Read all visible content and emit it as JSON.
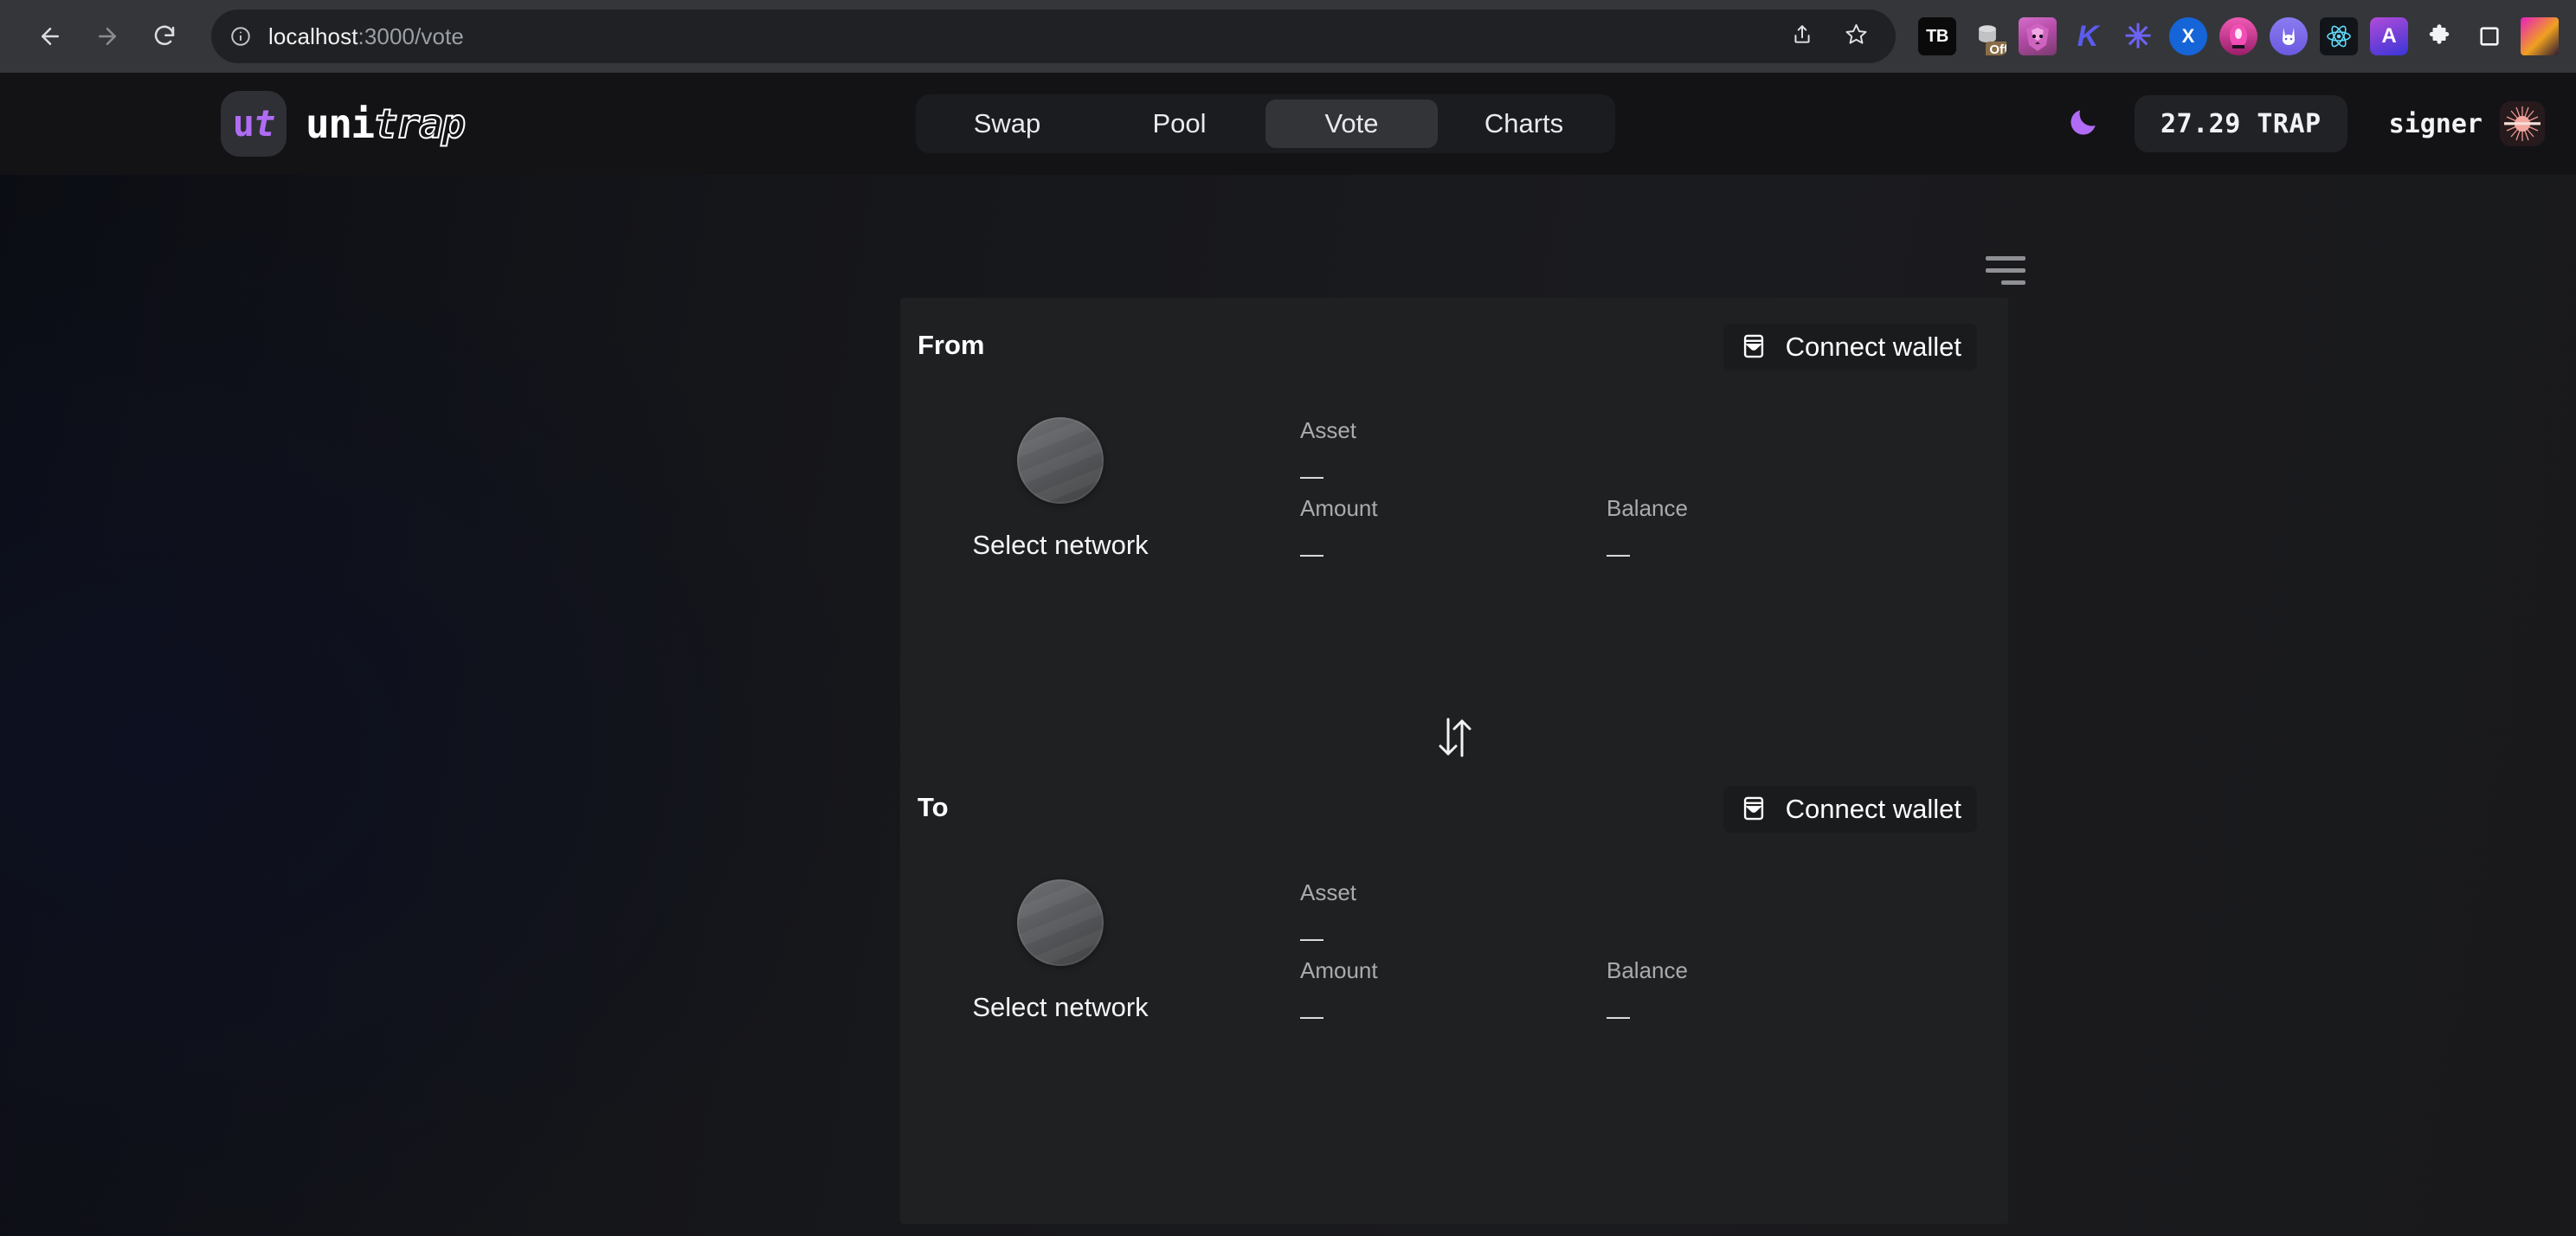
{
  "browser": {
    "back_icon": "back-arrow-icon",
    "forward_icon": "forward-arrow-icon",
    "reload_icon": "reload-icon",
    "site_info_icon": "info-circle-icon",
    "url_host": "localhost",
    "url_path": ":3000/vote",
    "share_icon": "share-icon",
    "bookmark_icon": "star-icon",
    "extensions": [
      {
        "name": "tb-extension",
        "label": "TB"
      },
      {
        "name": "cookie-off-extension",
        "label": "",
        "badge": "Off"
      },
      {
        "name": "metamask-extension",
        "label": ""
      },
      {
        "name": "keplr-extension",
        "label": "K"
      },
      {
        "name": "asterisk-extension",
        "label": "✳"
      },
      {
        "name": "x-extension",
        "label": "X"
      },
      {
        "name": "rainbow-extension",
        "label": ""
      },
      {
        "name": "rabby-extension",
        "label": ""
      },
      {
        "name": "react-devtools-extension",
        "label": "⚛"
      },
      {
        "name": "a-extension",
        "label": "A"
      },
      {
        "name": "extensions-puzzle-icon",
        "label": ""
      },
      {
        "name": "side-panel-icon",
        "label": ""
      },
      {
        "name": "profile-avatar",
        "label": ""
      }
    ]
  },
  "header": {
    "logo_badge_prefix": "u",
    "logo_badge_suffix": "t",
    "brand_solid": "uni",
    "brand_outline": "trap",
    "tabs": [
      {
        "label": "Swap",
        "active": false
      },
      {
        "label": "Pool",
        "active": false
      },
      {
        "label": "Vote",
        "active": true
      },
      {
        "label": "Charts",
        "active": false
      }
    ],
    "theme_toggle_icon": "moon-icon",
    "balance": "27.29 TRAP",
    "signer_name": "signer",
    "avatar_icon": "sunburst-avatar",
    "accent_purple": "#b06cf5",
    "menu_icon": "hamburger-menu-icon"
  },
  "swap": {
    "from": {
      "title": "From",
      "connect_label": "Connect wallet",
      "wallet_icon": "wallet-icon",
      "network_label": "Select network",
      "asset_label": "Asset",
      "asset_value": "—",
      "amount_label": "Amount",
      "amount_value": "—",
      "balance_label": "Balance",
      "balance_value": "—"
    },
    "to": {
      "title": "To",
      "connect_label": "Connect wallet",
      "wallet_icon": "wallet-icon",
      "network_label": "Select network",
      "asset_label": "Asset",
      "asset_value": "—",
      "amount_label": "Amount",
      "amount_value": "—",
      "balance_label": "Balance",
      "balance_value": "—"
    },
    "swap_direction_icon": "swap-arrows-icon"
  }
}
